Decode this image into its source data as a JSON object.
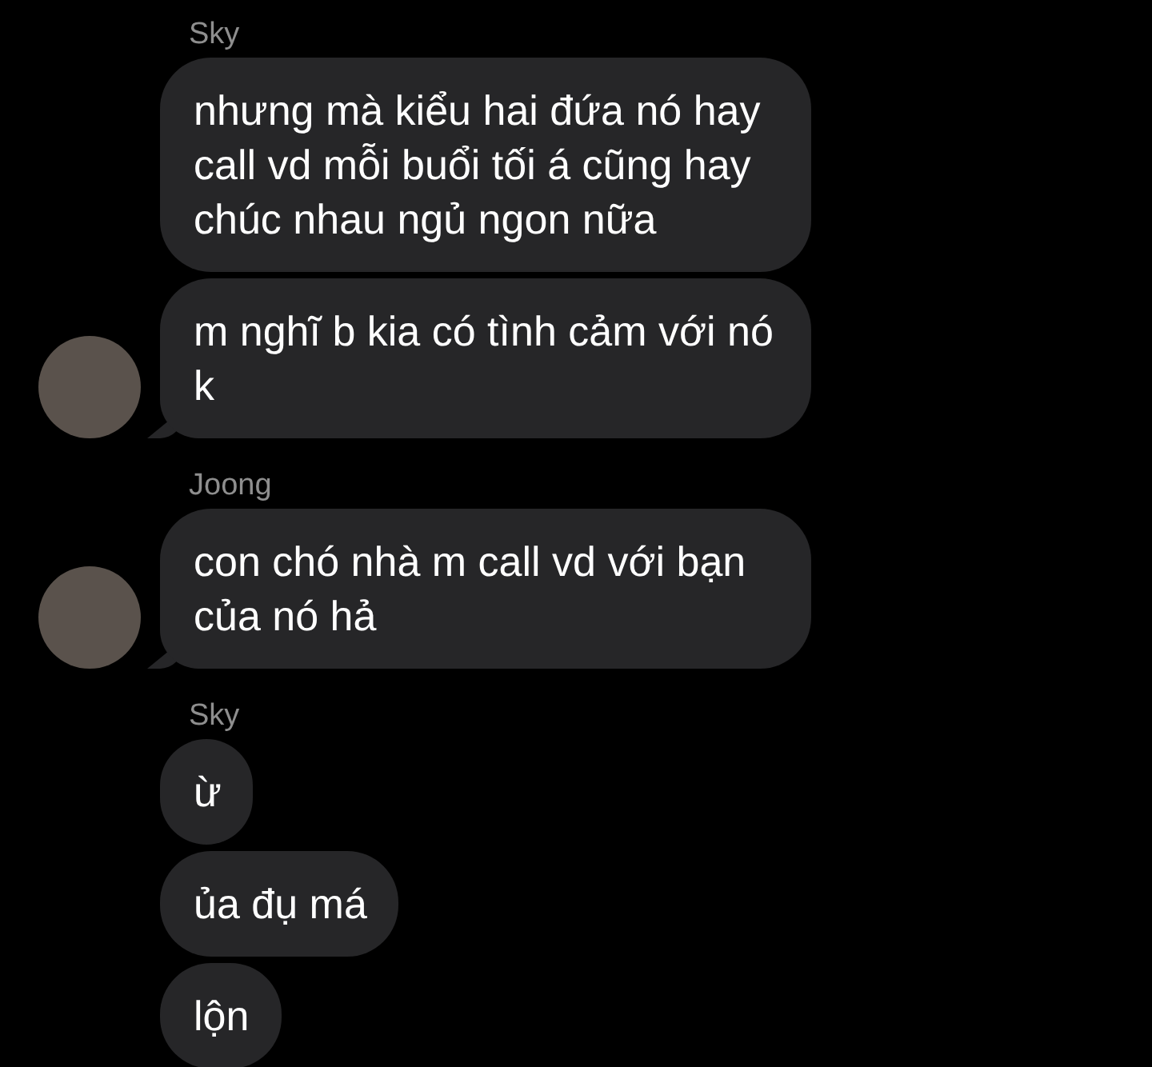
{
  "groups": [
    {
      "sender": "Sky",
      "messages": [
        {
          "text": "nhưng mà kiểu hai đứa nó hay call vd mỗi buổi tối á cũng hay chúc nhau ngủ ngon nữa",
          "avatar": false
        },
        {
          "text": "m nghĩ b kia có tình cảm với nó k",
          "avatar": true
        }
      ]
    },
    {
      "sender": "Joong",
      "messages": [
        {
          "text": "con chó nhà m call vd với bạn của nó hả",
          "avatar": true
        }
      ]
    },
    {
      "sender": "Sky",
      "messages": [
        {
          "text": "ừ",
          "avatar": false
        },
        {
          "text": "ủa đụ má",
          "avatar": false
        },
        {
          "text": "lộn",
          "avatar": false
        }
      ]
    }
  ]
}
